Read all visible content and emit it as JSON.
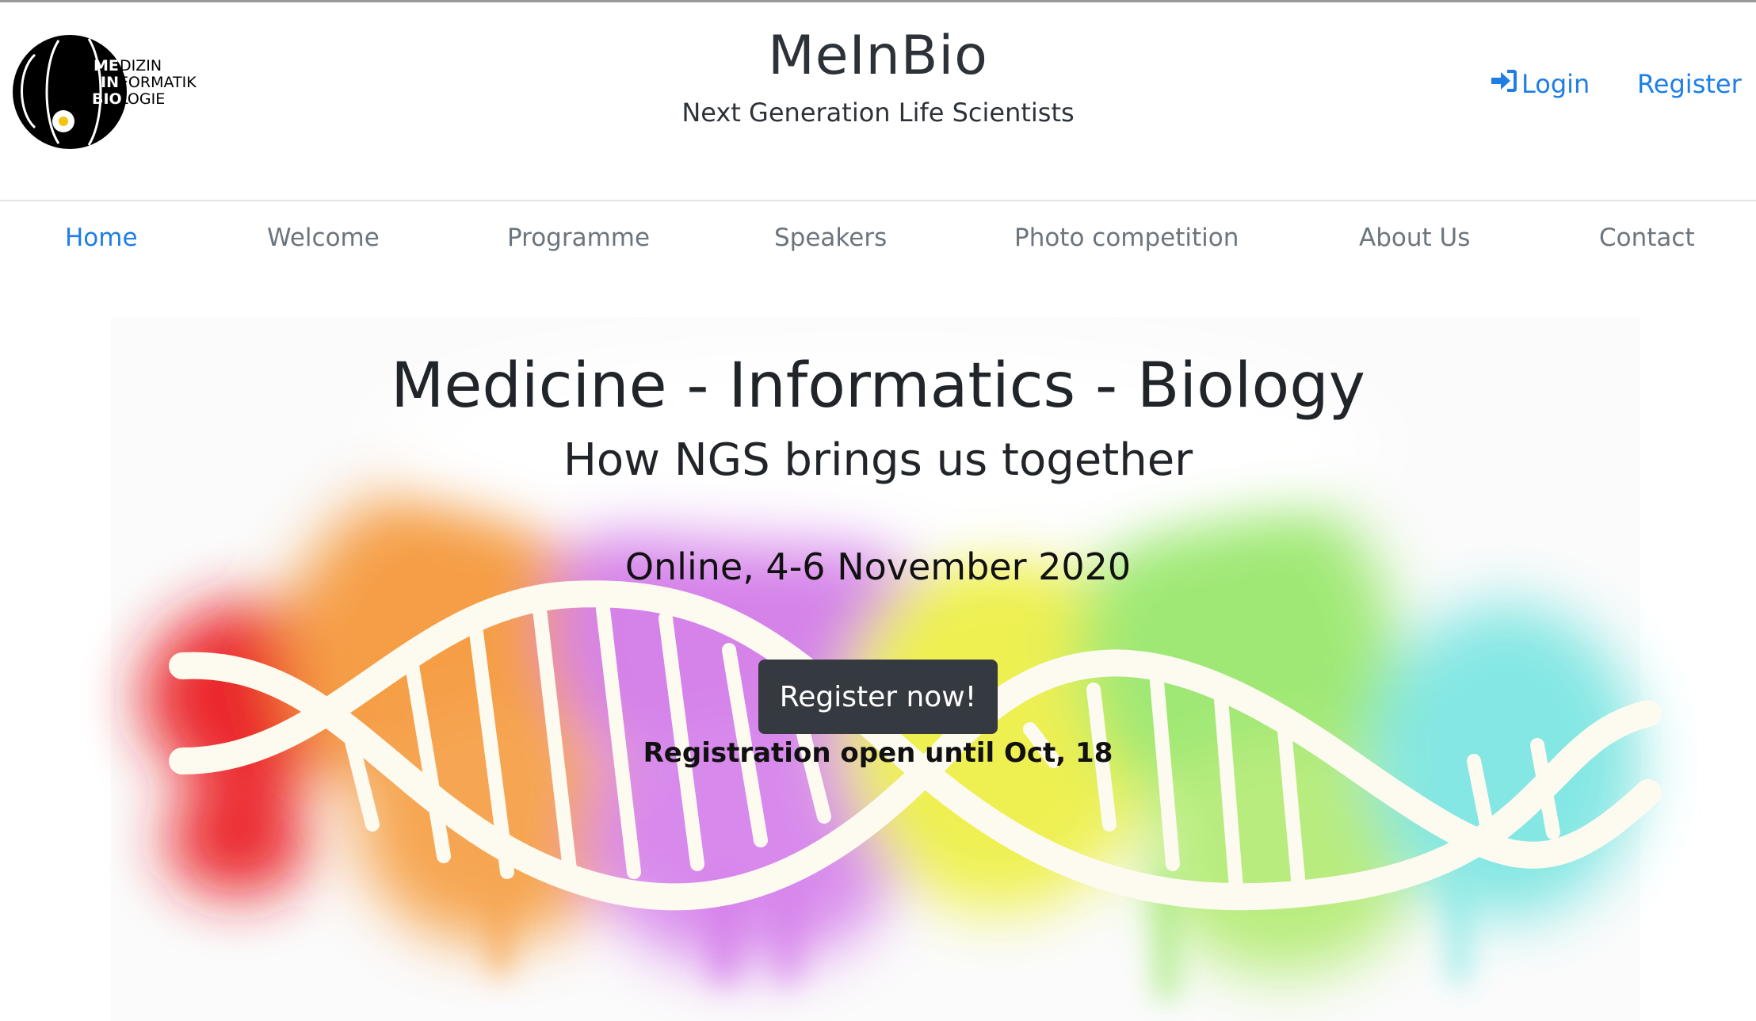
{
  "header": {
    "logo_text": [
      "ME",
      "DIZIN",
      "IN",
      "FORMATIK",
      "BIO",
      "LOGIE"
    ],
    "title": "MeInBio",
    "subtitle": "Next Generation Life Scientists",
    "login_label": "Login",
    "register_label": "Register",
    "icons": {
      "login": "sign-in-icon"
    }
  },
  "nav": {
    "items": [
      {
        "label": "Home",
        "active": true
      },
      {
        "label": "Welcome",
        "active": false
      },
      {
        "label": "Programme",
        "active": false
      },
      {
        "label": "Speakers",
        "active": false
      },
      {
        "label": "Photo competition",
        "active": false
      },
      {
        "label": "About Us",
        "active": false
      },
      {
        "label": "Contact",
        "active": false
      }
    ]
  },
  "hero": {
    "title": "Medicine - Informatics - Biology",
    "subtitle": "How NGS brings us together",
    "date": "Online, 4-6 November 2020",
    "cta_label": "Register now!",
    "note": "Registration open until Oct, 18"
  },
  "colors": {
    "link": "#1e7ee6",
    "nav_inactive": "#6c757d",
    "cta_background": "#343a40",
    "text": "#212529"
  }
}
